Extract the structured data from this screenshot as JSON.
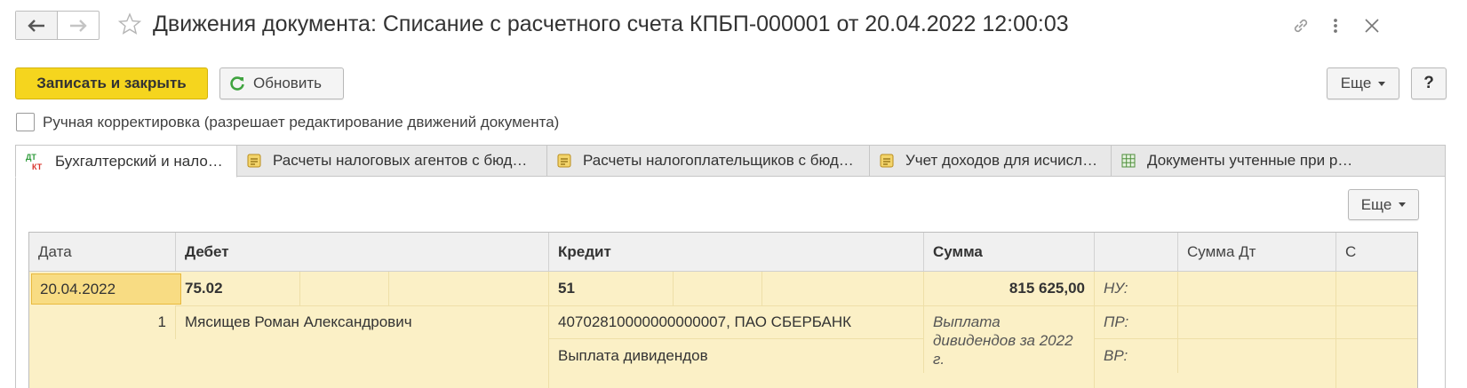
{
  "window": {
    "title": "Движения документа: Списание с расчетного счета КПБП-000001 от 20.04.2022 12:00:03"
  },
  "toolbar": {
    "save_close_label": "Записать и закрыть",
    "refresh_label": "Обновить",
    "more_label": "Еще",
    "help_label": "?"
  },
  "manual_edit": {
    "label": "Ручная корректировка (разрешает редактирование движений документа)",
    "checked": false
  },
  "tabs": [
    {
      "label": "Бухгалтерский и нало…",
      "icon": "dt-kt-icon",
      "active": true
    },
    {
      "label": "Расчеты налоговых агентов с бюд…",
      "icon": "register-icon",
      "active": false
    },
    {
      "label": "Расчеты налогоплательщиков с бюд…",
      "icon": "register-icon",
      "active": false
    },
    {
      "label": "Учет доходов для исчисл…",
      "icon": "register-icon",
      "active": false
    },
    {
      "label": "Документы учтенные при р…",
      "icon": "table-icon",
      "active": false
    }
  ],
  "panel": {
    "more_label": "Еще"
  },
  "grid": {
    "columns": [
      "Дата",
      "Дебет",
      "Кредит",
      "Сумма",
      "",
      "Сумма Дт",
      "С"
    ],
    "row": {
      "date": "20.04.2022",
      "line_no": "1",
      "debit_account": "75.02",
      "debit_subconto": "Мясищев Роман Александрович",
      "credit_account": "51",
      "credit_subconto_1": "40702810000000000007, ПАО СБЕРБАНК",
      "credit_subconto_2": "Выплата дивидендов",
      "sum": "815 625,00",
      "content_line1": "Выплата",
      "content_line2": "дивидендов за 2022",
      "content_line3": "г.",
      "nu_label": "НУ:",
      "pr_label": "ПР:",
      "vr_label": "ВР:"
    }
  },
  "colors": {
    "primary_button": "#f5d51e",
    "row_highlight": "#fbf0c6",
    "selected_cell": "#f8dc83",
    "refresh_icon": "#3fa33f"
  }
}
